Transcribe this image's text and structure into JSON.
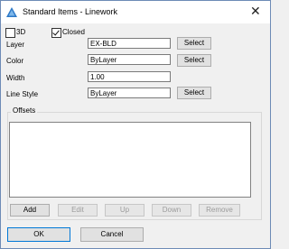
{
  "window": {
    "title": "Standard Items - Linework",
    "icon": "app-icon",
    "close": "close-icon"
  },
  "options": {
    "three_d": {
      "label": "3D",
      "checked": false
    },
    "closed": {
      "label": "Closed",
      "checked": true
    }
  },
  "fields": {
    "layer": {
      "label": "Layer",
      "value": "EX-BLD",
      "button": "Select"
    },
    "color": {
      "label": "Color",
      "value": "ByLayer",
      "button": "Select"
    },
    "width": {
      "label": "Width",
      "value": "1.00"
    },
    "line_style": {
      "label": "Line Style",
      "value": "ByLayer",
      "button": "Select"
    }
  },
  "offsets": {
    "label": "Offsets",
    "items": [],
    "buttons": {
      "add": {
        "label": "Add",
        "enabled": true
      },
      "edit": {
        "label": "Edit",
        "enabled": false
      },
      "up": {
        "label": "Up",
        "enabled": false
      },
      "down": {
        "label": "Down",
        "enabled": false
      },
      "remove": {
        "label": "Remove",
        "enabled": false
      }
    }
  },
  "footer": {
    "ok": "OK",
    "cancel": "Cancel"
  }
}
